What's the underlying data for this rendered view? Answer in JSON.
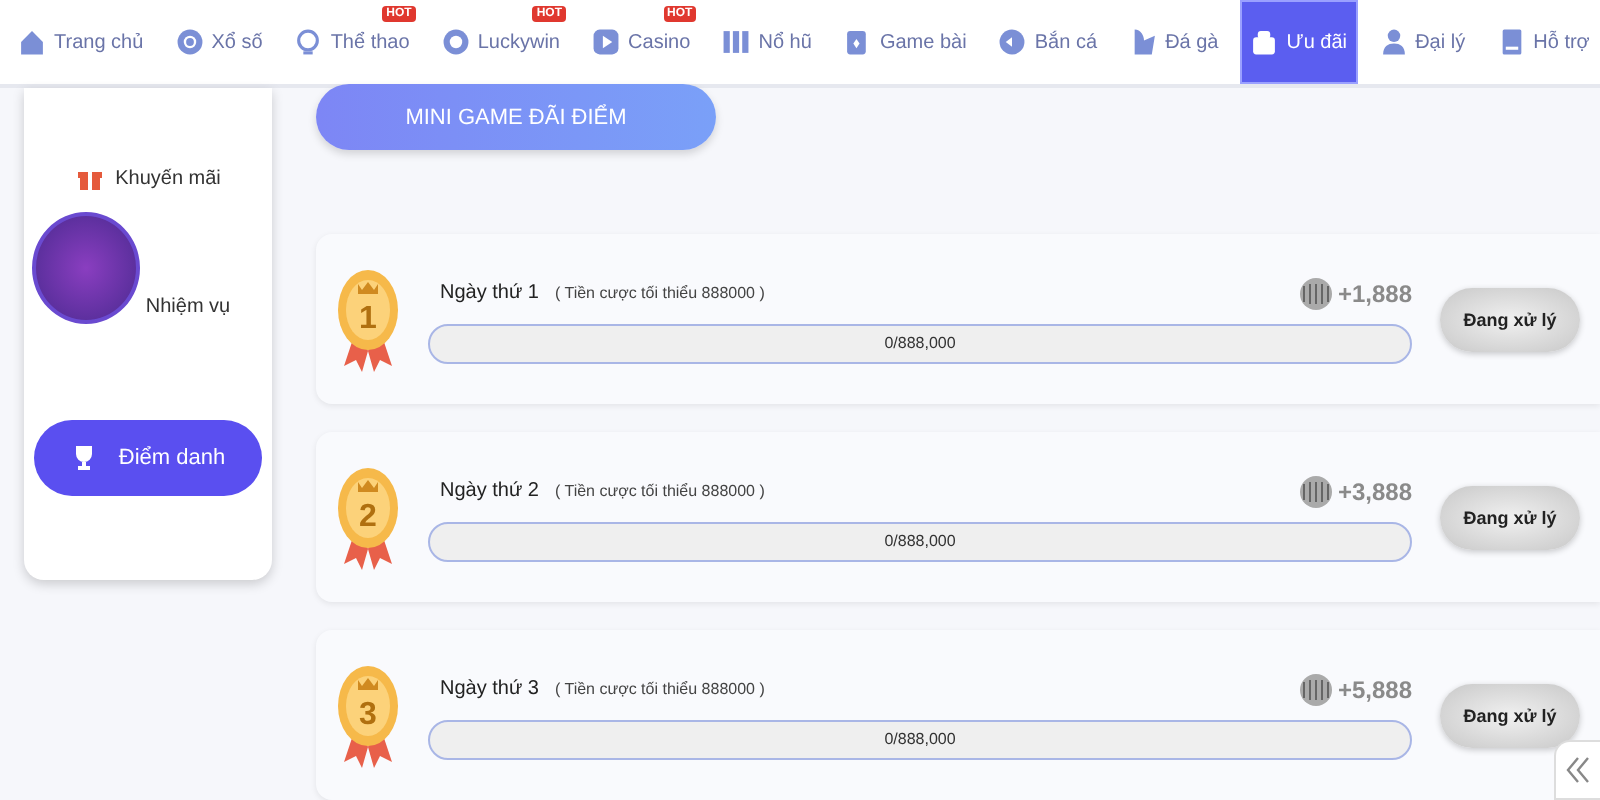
{
  "nav": {
    "tabs": [
      {
        "label": "Trang chủ",
        "selected": false
      },
      {
        "label": "Xổ số",
        "selected": false
      },
      {
        "label": "Thể thao",
        "badge": "HOT",
        "selected": false
      },
      {
        "label": "Luckywin",
        "badge": "HOT",
        "selected": false
      },
      {
        "label": "Casino",
        "badge": "HOT",
        "selected": false
      },
      {
        "label": "Nổ hũ",
        "selected": false
      },
      {
        "label": "Game bài",
        "selected": false
      },
      {
        "label": "Bắn cá",
        "selected": false
      },
      {
        "label": "Đá gà",
        "selected": false
      },
      {
        "label": "Ưu đãi",
        "selected": true
      },
      {
        "label": "Đại lý",
        "selected": false
      },
      {
        "label": "Hỗ trợ",
        "selected": false
      }
    ]
  },
  "sidebar": {
    "items": [
      {
        "label": "Khuyến mãi",
        "kind": "link",
        "selected": false
      },
      {
        "label": "Nhiệm vụ",
        "kind": "link",
        "selected": false
      },
      {
        "label": "Điểm danh",
        "kind": "button",
        "selected": true
      }
    ]
  },
  "main": {
    "title": "MINI GAME ĐÃI ĐIỂM",
    "days": [
      {
        "medal": "1",
        "title": "Ngày thứ 1",
        "note": "( Tiền cược tối thiểu 888000 )",
        "reward": "+1,888",
        "level": 0,
        "progress": "0/888,000",
        "status": "Đang xử lý"
      },
      {
        "medal": "2",
        "title": "Ngày thứ 2",
        "note": "( Tiền cược tối thiểu 888000 )",
        "reward": "+3,888",
        "level": 0,
        "progress": "0/888,000",
        "status": "Đang xử lý"
      },
      {
        "medal": "3",
        "title": "Ngày thứ 3",
        "note": "( Tiền cược tối thiểu 888000 )",
        "reward": "+5,888",
        "level": 0,
        "progress": "0/888,000",
        "status": "Đang xử lý"
      }
    ]
  }
}
